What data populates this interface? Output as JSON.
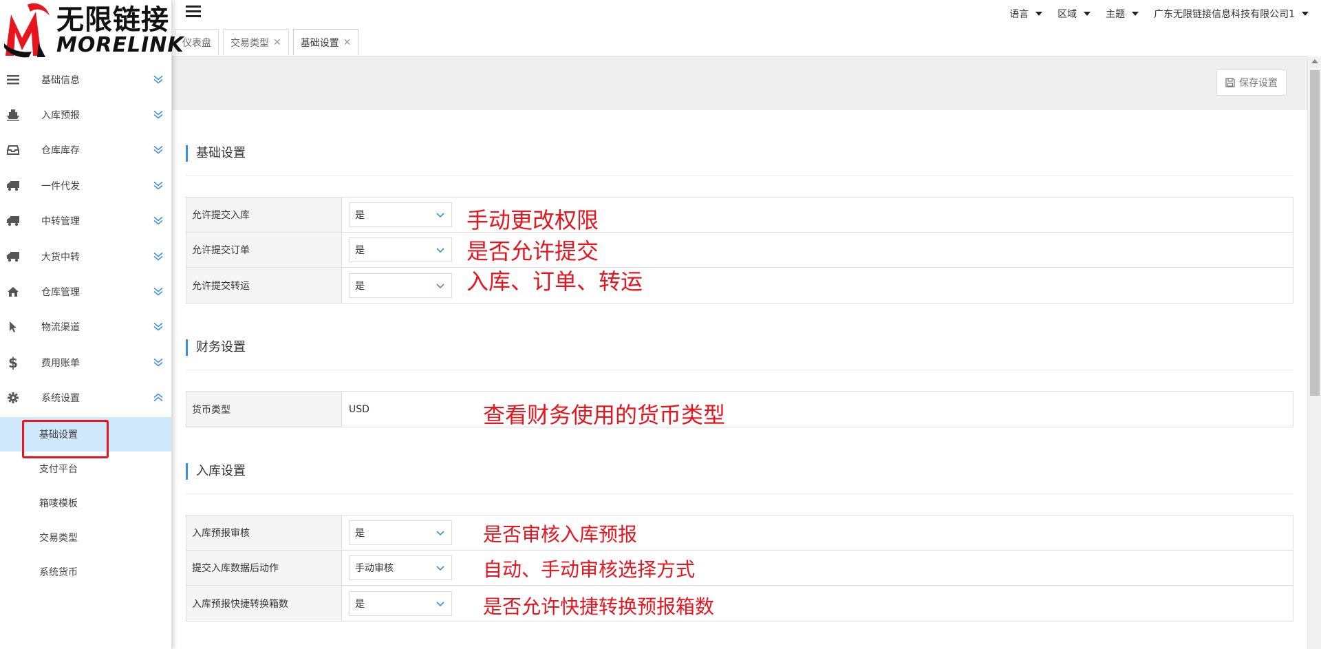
{
  "brand": {
    "cn": "无限链接",
    "en": "MORELINK",
    "accent": "#e8141e"
  },
  "sidebar": {
    "items": [
      {
        "label": "基础信息",
        "icon": "list-icon"
      },
      {
        "label": "入库预报",
        "icon": "ship-icon"
      },
      {
        "label": "仓库库存",
        "icon": "inbox-icon"
      },
      {
        "label": "一件代发",
        "icon": "truck-icon"
      },
      {
        "label": "中转管理",
        "icon": "truck-icon"
      },
      {
        "label": "大货中转",
        "icon": "truck-icon"
      },
      {
        "label": "仓库管理",
        "icon": "home-icon"
      },
      {
        "label": "物流渠道",
        "icon": "cursor-icon"
      },
      {
        "label": "费用账单",
        "icon": "dollar-icon"
      },
      {
        "label": "系统设置",
        "icon": "gear-icon"
      }
    ],
    "subitems": [
      "基础设置",
      "支付平台",
      "箱唛模板",
      "交易类型",
      "系统货币"
    ]
  },
  "topbar": {
    "language": "语言",
    "region": "区域",
    "theme": "主题",
    "company": "广东无限链接信息科技有限公司1"
  },
  "tabs": [
    {
      "label": "仪表盘",
      "closable": false
    },
    {
      "label": "交易类型",
      "closable": true
    },
    {
      "label": "基础设置",
      "closable": true
    }
  ],
  "toolbar": {
    "save_label": "保存设置"
  },
  "sections": {
    "basic": {
      "title": "基础设置",
      "rows": [
        {
          "label": "允许提交入库",
          "value": "是"
        },
        {
          "label": "允许提交订单",
          "value": "是"
        },
        {
          "label": "允许提交转运",
          "value": "是"
        }
      ]
    },
    "finance": {
      "title": "财务设置",
      "rows": [
        {
          "label": "货币类型",
          "value": "USD"
        }
      ]
    },
    "inbound": {
      "title": "入库设置",
      "rows": [
        {
          "label": "入库预报审核",
          "value": "是"
        },
        {
          "label": "提交入库数据后动作",
          "value": "手动审核"
        },
        {
          "label": "入库预报快捷转换箱数",
          "value": "是"
        }
      ]
    }
  },
  "annotations": {
    "a1": "手动更改权限",
    "a2": "是否允许提交",
    "a3": "入库、订单、转运",
    "a4": "查看财务使用的货币类型",
    "a5": "是否审核入库预报",
    "a6": "自动、手动审核选择方式",
    "a7": "是否允许快捷转换预报箱数"
  }
}
